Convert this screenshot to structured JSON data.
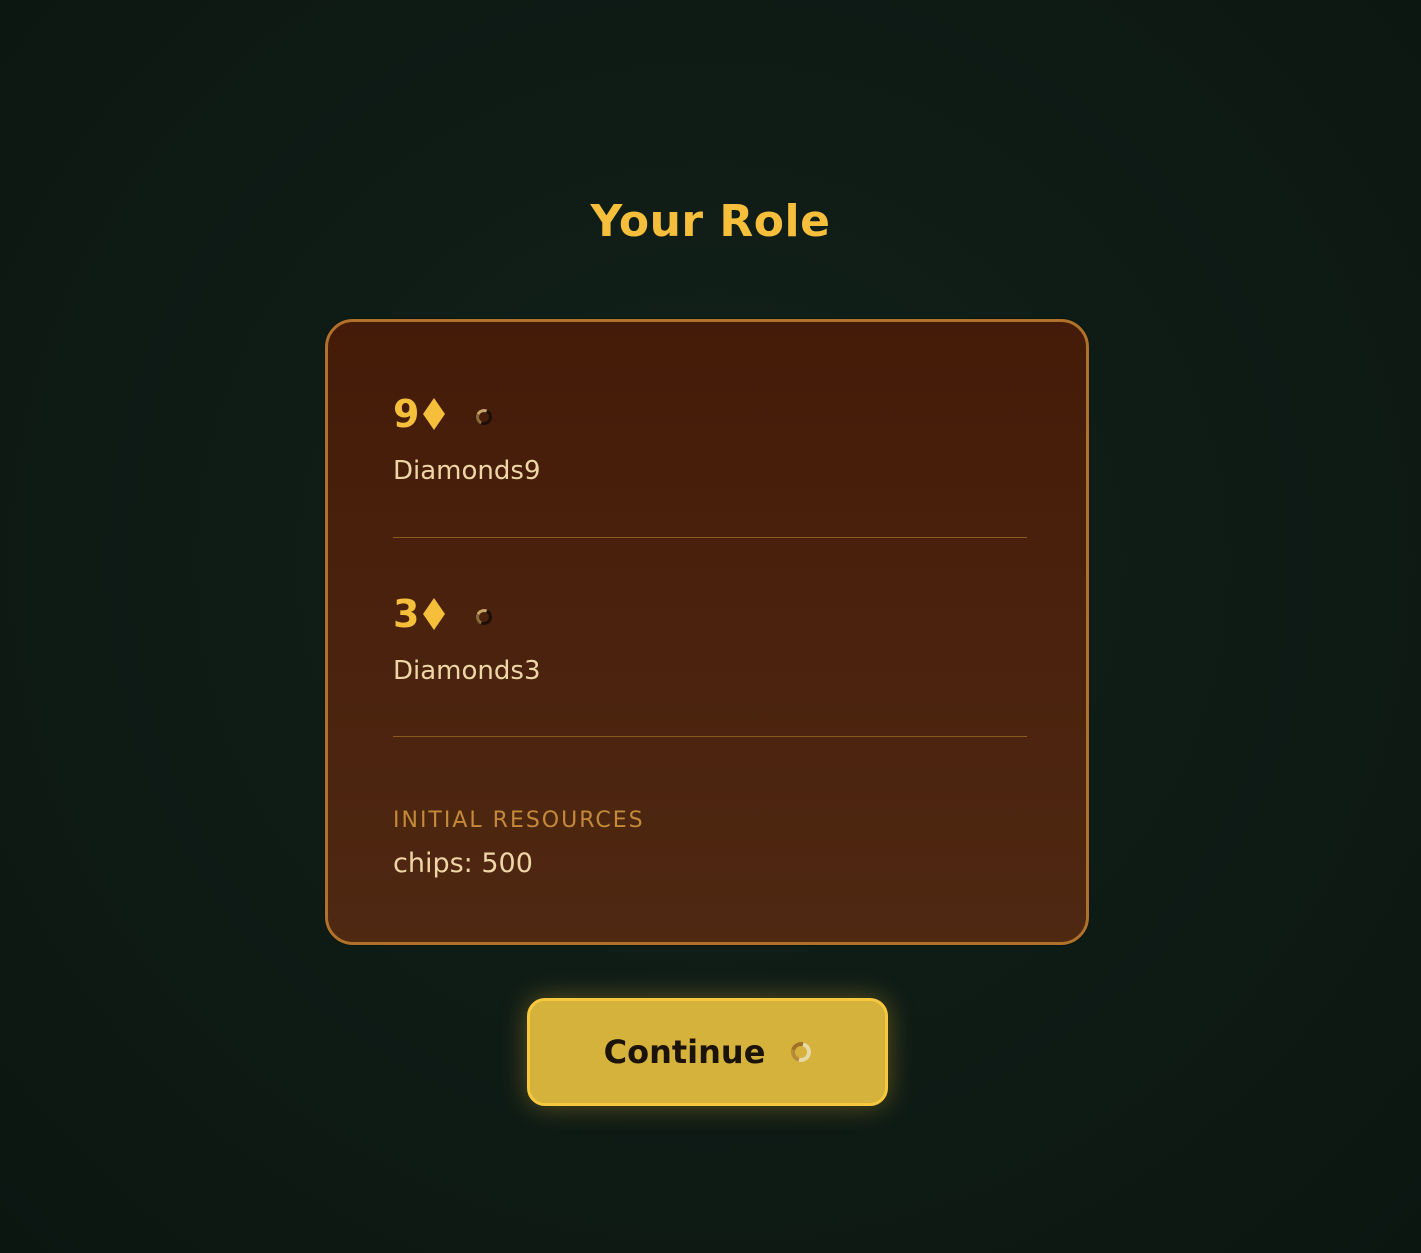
{
  "page": {
    "title": "Your Role"
  },
  "cards": [
    {
      "rank": "9",
      "suit": "diamond-icon",
      "name": "Diamonds9"
    },
    {
      "rank": "3",
      "suit": "diamond-icon",
      "name": "Diamonds3"
    }
  ],
  "resources": {
    "label": "INITIAL RESOURCES",
    "value": "chips: 500"
  },
  "actions": {
    "continue_label": "Continue"
  },
  "colors": {
    "accent": "#f5bf3c",
    "card_background": "#4a220d",
    "card_border": "#b0722a",
    "button_background": "#d4b23c",
    "page_background": "#0f1c16"
  }
}
